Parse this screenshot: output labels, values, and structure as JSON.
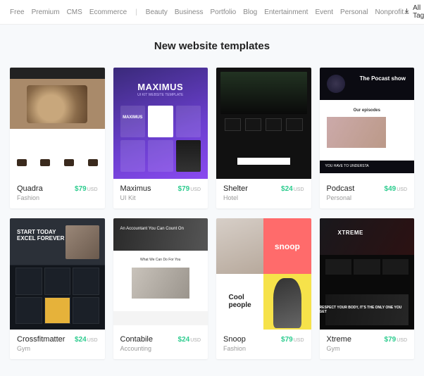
{
  "filterbar": {
    "filters": [
      "Free",
      "Premium",
      "CMS",
      "Ecommerce"
    ],
    "categories": [
      "Beauty",
      "Business",
      "Portfolio",
      "Blog",
      "Entertainment",
      "Event",
      "Personal",
      "Nonprofit"
    ],
    "all_tags_label": "All Tags"
  },
  "section": {
    "title": "New website templates"
  },
  "templates": [
    {
      "name": "Quadra",
      "price": "$79",
      "currency": "USD",
      "category": "Fashion"
    },
    {
      "name": "Maximus",
      "price": "$79",
      "currency": "USD",
      "category": "UI Kit"
    },
    {
      "name": "Shelter",
      "price": "$24",
      "currency": "USD",
      "category": "Hotel"
    },
    {
      "name": "Podcast",
      "price": "$49",
      "currency": "USD",
      "category": "Personal"
    },
    {
      "name": "Crossfitmatter",
      "price": "$24",
      "currency": "USD",
      "category": "Gym"
    },
    {
      "name": "Contabile",
      "price": "$24",
      "currency": "USD",
      "category": "Accounting"
    },
    {
      "name": "Snoop",
      "price": "$79",
      "currency": "USD",
      "category": "Fashion"
    },
    {
      "name": "Xtreme",
      "price": "$79",
      "currency": "USD",
      "category": "Gym"
    }
  ],
  "thumb_text": {
    "maximus_logo": "MAXIMUS",
    "maximus_sub": "UI KIT WEBSITE TEMPLATE",
    "podcast_title": "The Pocast show",
    "podcast_episodes": "Our episodes",
    "podcast_bar": "YOU HAVE TO UNDERSTA",
    "crossfit_line1": "START TODAY",
    "crossfit_line2": "EXCEL FOREVER",
    "contabile_hero": "An Accountant You Can Count On",
    "contabile_mid": "What We Can Do For You",
    "snoop_b": "snoop",
    "snoop_c": "Cool\npeople",
    "xtreme_txt": "XTREME",
    "xtreme_btxt": "RESPECT YOUR BODY, IT'S THE ONLY ONE YOU GET"
  }
}
